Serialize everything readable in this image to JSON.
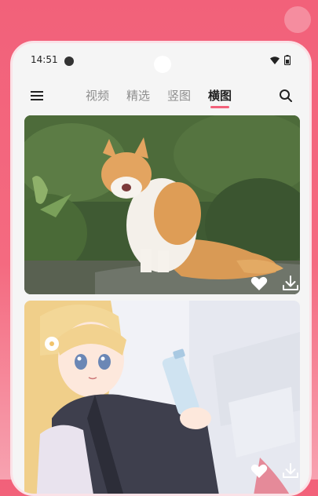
{
  "status_bar": {
    "time": "14:51"
  },
  "nav": {
    "tabs": [
      {
        "label": "视频",
        "active": false
      },
      {
        "label": "精选",
        "active": false
      },
      {
        "label": "竖图",
        "active": false
      },
      {
        "label": "横图",
        "active": true
      }
    ]
  },
  "colors": {
    "accent": "#f2617a",
    "background": "#f5f5f5"
  },
  "icons": [
    "menu-icon",
    "search-icon",
    "heart-icon",
    "download-icon",
    "wifi-icon",
    "battery-icon"
  ],
  "cards": [
    {
      "subject": "cat photo",
      "actions": [
        "heart-icon",
        "download-icon"
      ]
    },
    {
      "subject": "anime illustration",
      "actions": [
        "heart-icon",
        "download-icon"
      ]
    }
  ]
}
